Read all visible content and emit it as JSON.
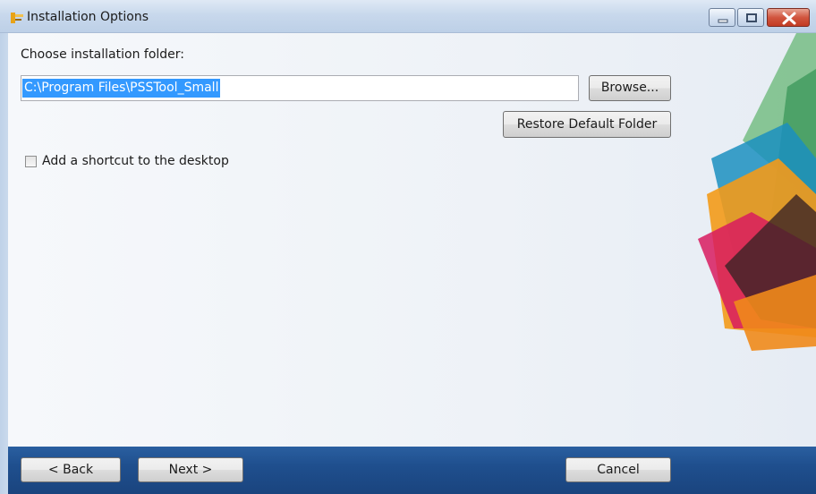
{
  "window": {
    "title": "Installation Options",
    "app_icon": "installer-icon"
  },
  "caption_buttons": {
    "minimize_icon": "minimize-icon",
    "maximize_icon": "maximize-icon",
    "close_icon": "close-icon"
  },
  "folder": {
    "label": "Choose installation folder:",
    "path_value": "C:\\Program Files\\PSSTool_Small",
    "browse_label": "Browse...",
    "restore_label": "Restore Default Folder"
  },
  "shortcut": {
    "label": "Add a shortcut to the desktop",
    "checked": false
  },
  "footer": {
    "back_label": "< Back",
    "next_label": "Next >",
    "cancel_label": "Cancel"
  },
  "colors": {
    "footer_bar": "#1f4f8e",
    "selection": "#3399ff",
    "close_button": "#c23b23"
  }
}
